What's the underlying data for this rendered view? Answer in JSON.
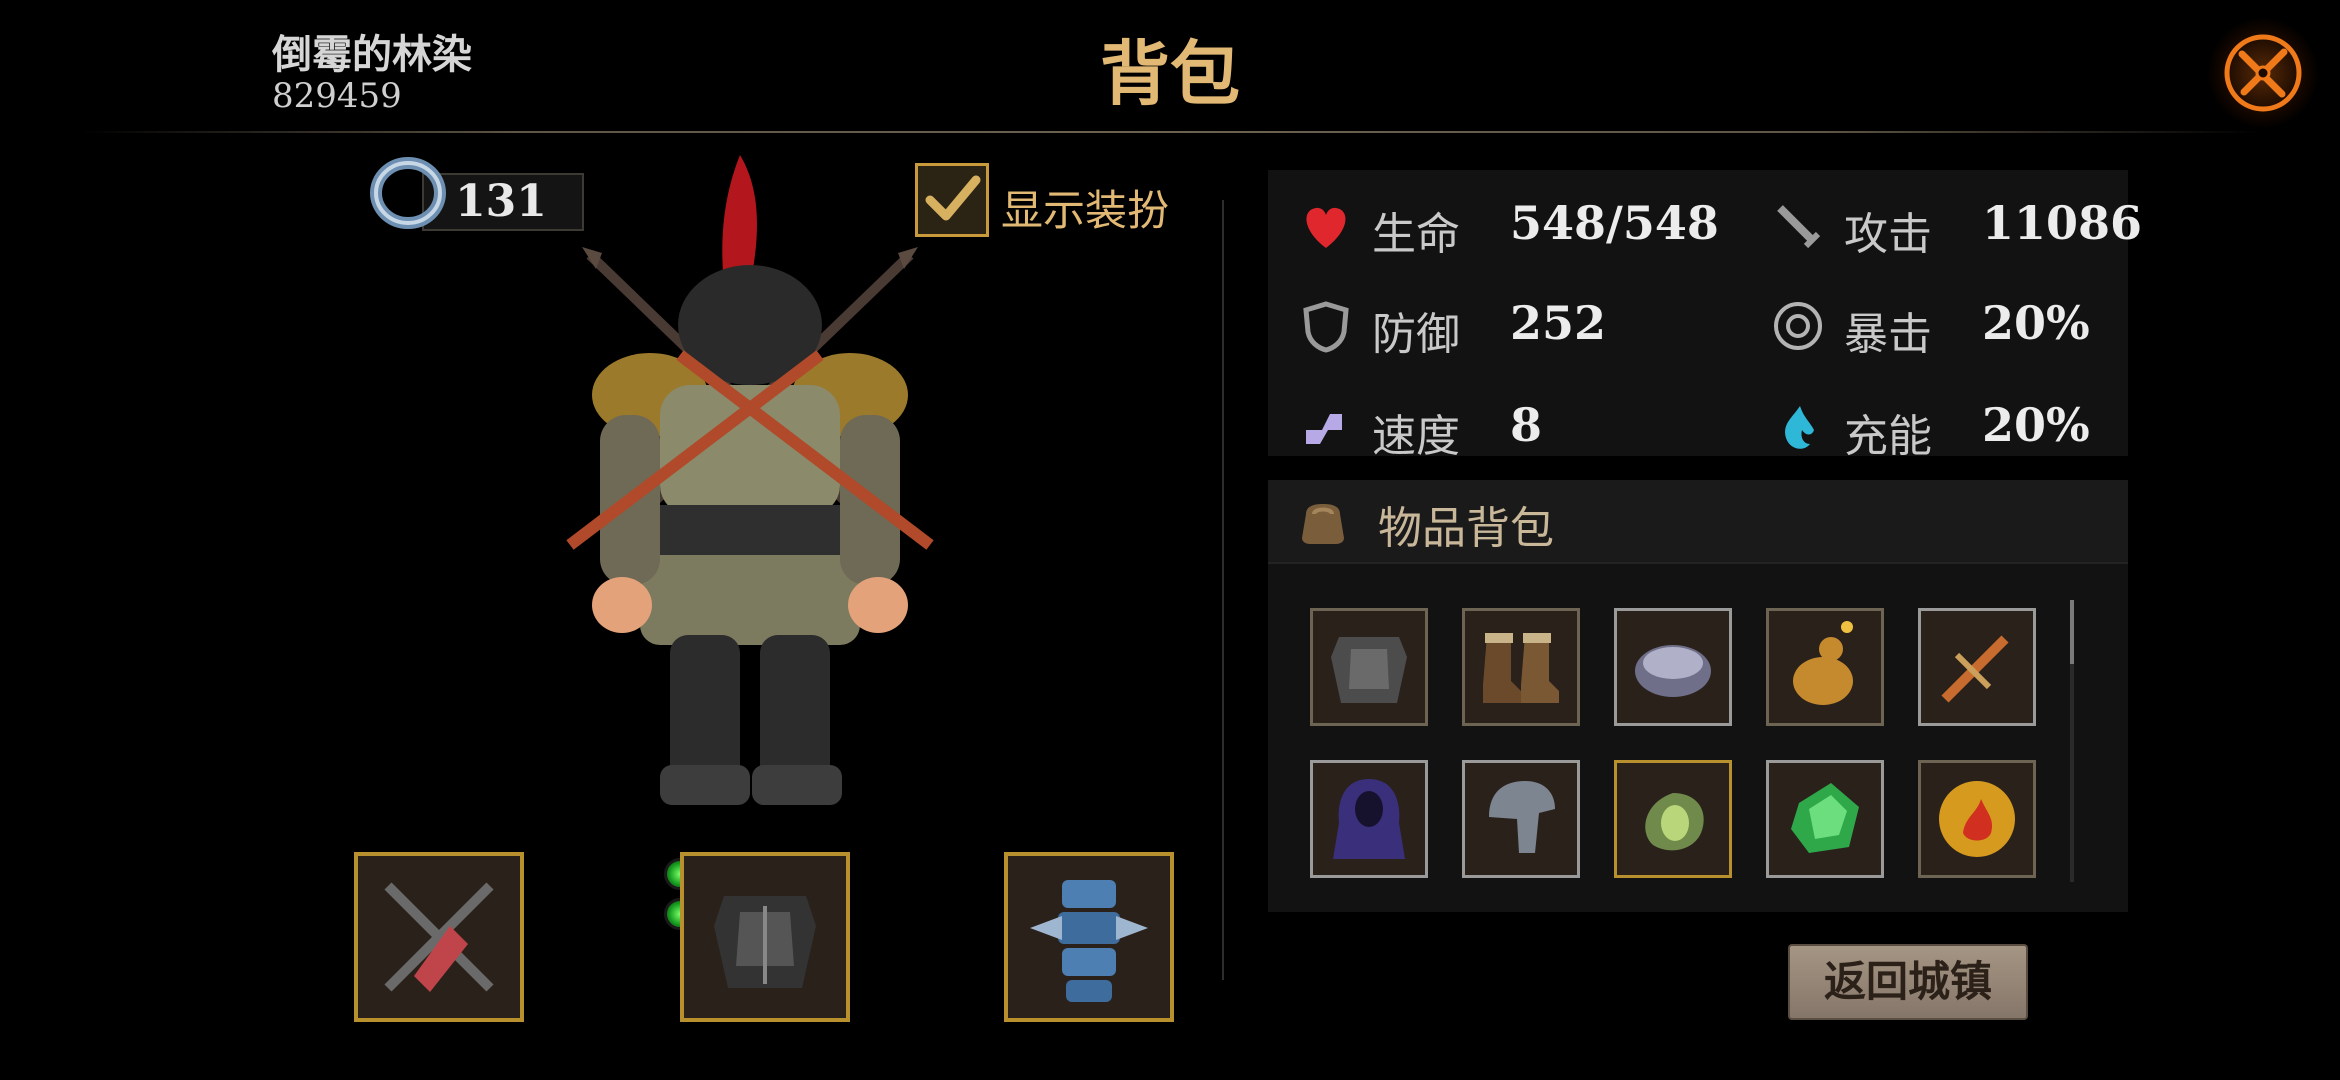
{
  "header": {
    "player_name": "倒霉的林染",
    "player_id": "829459",
    "title": "背包",
    "close_icon": "close-crossed-swords-icon"
  },
  "currency": {
    "icon": "ring-icon",
    "value": "131"
  },
  "show_outfit": {
    "label": "显示装扮",
    "checked": true
  },
  "equipment_slots": [
    {
      "icon": "crossed-daggers-icon",
      "frame": "gold"
    },
    {
      "icon": "dark-armor-icon",
      "frame": "gold",
      "upgrade_dots": 2
    },
    {
      "icon": "blue-leg-armor-icon",
      "frame": "gold"
    }
  ],
  "stats": [
    {
      "icon": "heart-icon",
      "name": "生命",
      "value": "548/548",
      "color": "#e0272d"
    },
    {
      "icon": "sword-icon",
      "name": "攻击",
      "value": "11086",
      "color": "#9a9a9a"
    },
    {
      "icon": "shield-icon",
      "name": "防御",
      "value": "252",
      "color": "#9a9a9a"
    },
    {
      "icon": "crit-target-icon",
      "name": "暴击",
      "value": "20%",
      "color": "#b3b3b3"
    },
    {
      "icon": "boot-speed-icon",
      "name": "速度",
      "value": "8",
      "color": "#b7a8e6"
    },
    {
      "icon": "energy-flame-icon",
      "name": "充能",
      "value": "20%",
      "color": "#2fb7d8"
    }
  ],
  "bag": {
    "icon": "bag-icon",
    "title": "物品背包",
    "items": [
      {
        "icon": "chest-armor-icon",
        "frame": "normal"
      },
      {
        "icon": "boots-icon",
        "frame": "normal"
      },
      {
        "icon": "bracer-icon",
        "frame": "silver"
      },
      {
        "icon": "potion-gourd-icon",
        "frame": "normal"
      },
      {
        "icon": "dagger-icon",
        "frame": "silver"
      },
      {
        "icon": "purple-cloak-icon",
        "frame": "silver"
      },
      {
        "icon": "helmet-icon",
        "frame": "silver"
      },
      {
        "icon": "green-amulet-icon",
        "frame": "gold"
      },
      {
        "icon": "green-gem-icon",
        "frame": "silver"
      },
      {
        "icon": "fire-coin-icon",
        "frame": "normal"
      }
    ]
  },
  "back_button": {
    "label": "返回城镇"
  }
}
